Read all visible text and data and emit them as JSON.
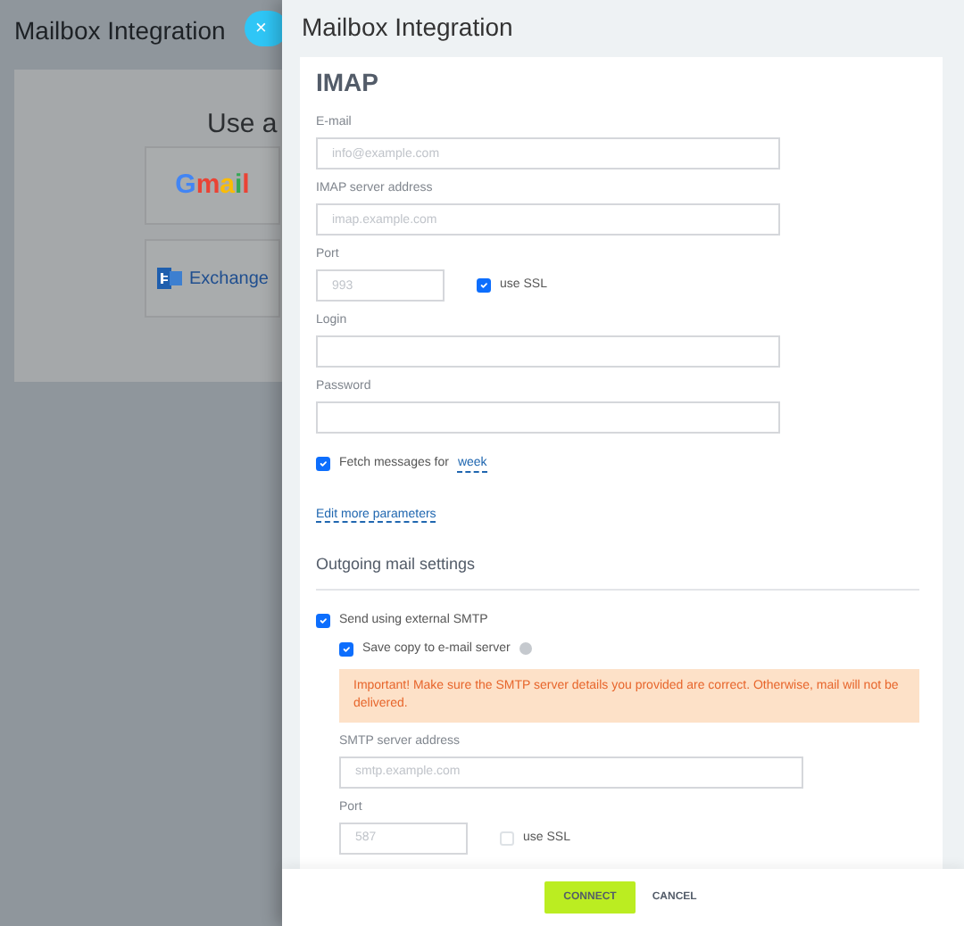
{
  "background": {
    "title": "Mailbox Integration",
    "heading": "Use a",
    "services": [
      {
        "kind": "gmail",
        "label": "Gmail"
      },
      {
        "kind": "exchange",
        "label": "Exchange"
      }
    ]
  },
  "close_button": "×",
  "panel": {
    "title": "Mailbox Integration",
    "section": "IMAP",
    "items": [
      {
        "kind": "field",
        "label": "E-mail",
        "placeholder": "info@example.com"
      },
      {
        "kind": "field",
        "label": "IMAP server address",
        "placeholder": "imap.example.com"
      },
      {
        "kind": "port",
        "label": "Port",
        "placeholder": "993",
        "ssl": {
          "label": "use SSL",
          "checked": true
        }
      },
      {
        "kind": "field",
        "label": "Login"
      },
      {
        "kind": "field",
        "label": "Password"
      },
      {
        "kind": "checkbox",
        "label": "Fetch messages for",
        "link": "week",
        "checked": true
      },
      {
        "kind": "link",
        "label": "Edit more parameters"
      },
      {
        "kind": "heading",
        "label": "Outgoing mail settings"
      },
      {
        "kind": "checkbox",
        "label": "Send using external SMTP",
        "checked": true,
        "children": [
          {
            "kind": "checkbox",
            "label": "Save copy to e-mail server",
            "checked": true,
            "help": true
          },
          {
            "kind": "alert",
            "label": "Important! Make sure the SMTP server details you provided are correct. Otherwise, mail will not be delivered."
          },
          {
            "kind": "wide",
            "label": "SMTP server address",
            "placeholder": "smtp.example.com"
          },
          {
            "kind": "port",
            "label": "Port",
            "placeholder": "587",
            "ssl": {
              "label": "use SSL",
              "checked": false
            }
          }
        ]
      }
    ]
  },
  "footer": [
    {
      "kind": "primary",
      "label": "CONNECT"
    },
    {
      "kind": "plain",
      "label": "CANCEL"
    }
  ]
}
